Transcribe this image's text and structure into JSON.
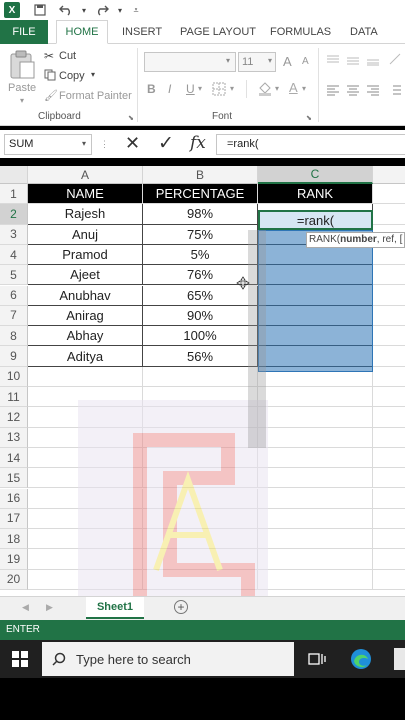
{
  "titlebar": {
    "logo": "X",
    "save_icon": "save-icon",
    "undo_icon": "undo-icon",
    "redo_icon": "redo-icon",
    "customize_icon": "customize-icon"
  },
  "tabs": [
    "FILE",
    "HOME",
    "INSERT",
    "PAGE LAYOUT",
    "FORMULAS",
    "DATA"
  ],
  "ribbon": {
    "paste": "Paste",
    "cut": "Cut",
    "copy": "Copy",
    "format_painter": "Format Painter",
    "clipboard_label": "Clipboard",
    "font_size": "11",
    "grow_font": "A",
    "shrink_font": "A",
    "bold": "B",
    "italic": "I",
    "underline": "U",
    "font_label": "Font"
  },
  "formula_bar": {
    "name_box": "SUM",
    "cancel": "✕",
    "enter": "✓",
    "fx": "fx",
    "formula": "=rank("
  },
  "columns": [
    "A",
    "B",
    "C"
  ],
  "rows": [
    "1",
    "2",
    "3",
    "4",
    "5",
    "6",
    "7",
    "8",
    "9",
    "10",
    "11",
    "12",
    "13",
    "14",
    "15",
    "16",
    "17",
    "18",
    "19",
    "20"
  ],
  "table": {
    "headers": [
      "NAME",
      "PERCENTAGE",
      "RANK"
    ],
    "data": [
      [
        "Rajesh",
        "98%"
      ],
      [
        "Anuj",
        "75%"
      ],
      [
        "Pramod",
        "5%"
      ],
      [
        "Ajeet",
        "76%"
      ],
      [
        "Anubhav",
        "65%"
      ],
      [
        "Anirag",
        "90%"
      ],
      [
        "Abhay",
        "100%"
      ],
      [
        "Aditya",
        "56%"
      ]
    ]
  },
  "active_cell_text": "=rank(",
  "tooltip": {
    "func": "RANK(",
    "arg_bold": "number",
    "rest": ", ref, ["
  },
  "sheet_tab": "Sheet1",
  "status": "ENTER",
  "taskbar": {
    "search_placeholder": "Type here to search"
  },
  "colors": {
    "excel_green": "#217346",
    "selection_blue": "#2e75b6"
  }
}
